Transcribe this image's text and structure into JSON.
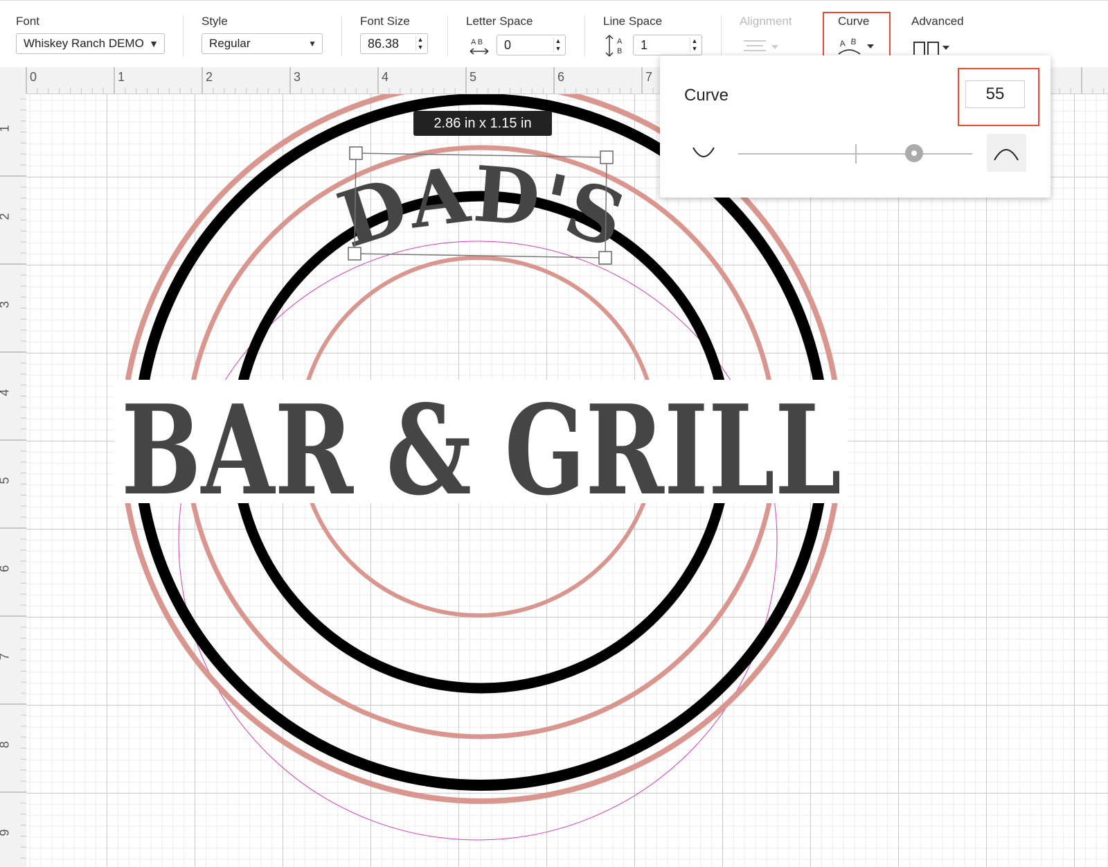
{
  "toolbar": {
    "font_label": "Font",
    "font_value": "Whiskey Ranch DEMO",
    "style_label": "Style",
    "style_value": "Regular",
    "font_size_label": "Font Size",
    "font_size_value": "86.38",
    "letter_space_label": "Letter Space",
    "letter_space_value": "0",
    "line_space_label": "Line Space",
    "line_space_value": "1",
    "alignment_label": "Alignment",
    "curve_label": "Curve",
    "advanced_label": "Advanced"
  },
  "ruler": {
    "top": [
      "0",
      "1",
      "2",
      "3",
      "4",
      "5",
      "6",
      "7"
    ],
    "left": [
      "1",
      "2",
      "3",
      "4",
      "5",
      "6",
      "7",
      "8",
      "9"
    ]
  },
  "canvas": {
    "dimension_label": "2.86  in x 1.15  in",
    "text_top": "DAD'S",
    "text_main": "BAR & GRILL"
  },
  "curve_popup": {
    "title": "Curve",
    "value": "55",
    "slider_fraction": 0.75
  },
  "colors": {
    "pink_ring": "#d9968f",
    "black_ring": "#000000",
    "text_fill": "#454545",
    "highlight": "#e8492f",
    "guide_circle": "#d63bb5"
  },
  "icons": {
    "letter_space": "letter-space-icon",
    "line_space": "line-space-icon",
    "alignment": "align-icon",
    "curve": "curve-text-icon",
    "advanced": "advanced-icon"
  }
}
